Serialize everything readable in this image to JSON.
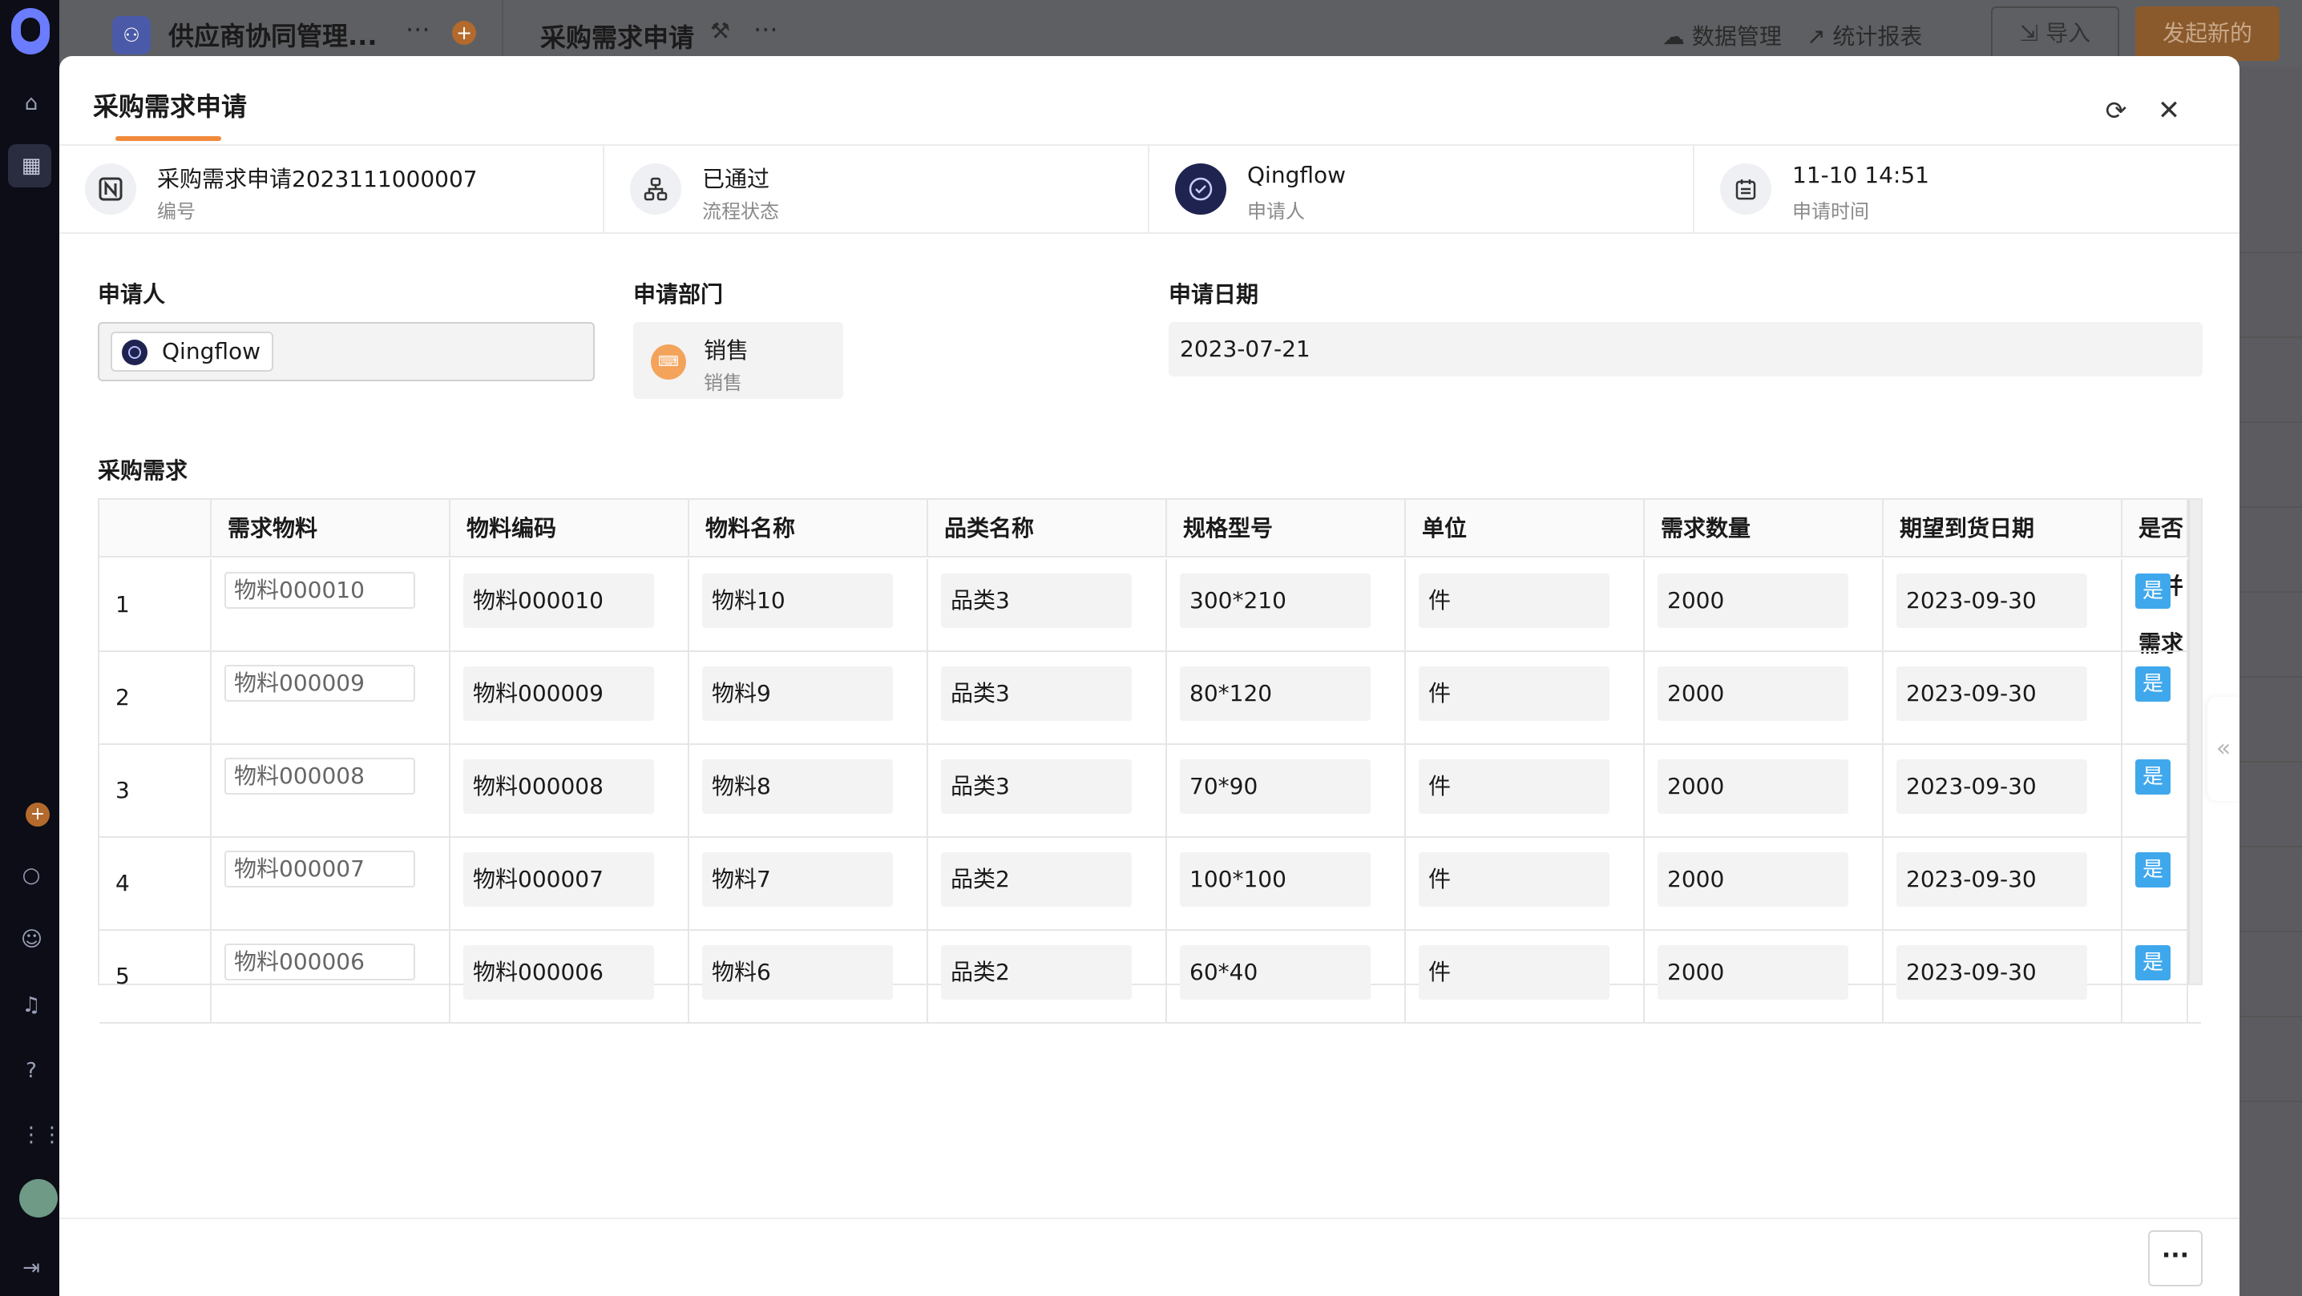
{
  "background": {
    "app_name": "供应商协同管理...",
    "page_title": "采购需求申请",
    "nav_links": [
      "数据管理",
      "统计报表"
    ],
    "import_label": "导入",
    "new_label": "发起新的"
  },
  "modal": {
    "title": "采购需求申请",
    "info": [
      {
        "value": "采购需求申请2023111000007",
        "label": "编号",
        "icon": "record-number-icon"
      },
      {
        "value": "已通过",
        "label": "流程状态",
        "icon": "workflow-icon"
      },
      {
        "value": "Qingflow",
        "label": "申请人",
        "icon": "avatar"
      },
      {
        "value": "11-10 14:51",
        "label": "申请时间",
        "icon": "calendar-icon"
      }
    ],
    "fields": {
      "applicant_label": "申请人",
      "applicant_value": "Qingflow",
      "department_label": "申请部门",
      "department_name": "销售",
      "department_sub": "销售",
      "date_label": "申请日期",
      "date_value": "2023-07-21"
    },
    "table": {
      "section_title": "采购需求",
      "headers": [
        "",
        "需求物料",
        "物料编码",
        "物料名称",
        "品类名称",
        "规格型号",
        "单位",
        "需求数量",
        "期望到货日期",
        "是否合并需求"
      ],
      "rows": [
        [
          "1",
          "物料000010",
          "物料000010",
          "物料10",
          "品类3",
          "300*210",
          "件",
          "2000",
          "2023-09-30",
          "是"
        ],
        [
          "2",
          "物料000009",
          "物料000009",
          "物料9",
          "品类3",
          "80*120",
          "件",
          "2000",
          "2023-09-30",
          "是"
        ],
        [
          "3",
          "物料000008",
          "物料000008",
          "物料8",
          "品类3",
          "70*90",
          "件",
          "2000",
          "2023-09-30",
          "是"
        ],
        [
          "4",
          "物料000007",
          "物料000007",
          "物料7",
          "品类2",
          "100*100",
          "件",
          "2000",
          "2023-09-30",
          "是"
        ],
        [
          "5",
          "物料000006",
          "物料000006",
          "物料6",
          "品类2",
          "60*40",
          "件",
          "2000",
          "2023-09-30",
          "是"
        ]
      ]
    },
    "more_label": "···"
  },
  "colors": {
    "accent": "#f08a3c",
    "badge_blue": "#3fa8ec",
    "avatar_dark": "#1f2350"
  }
}
